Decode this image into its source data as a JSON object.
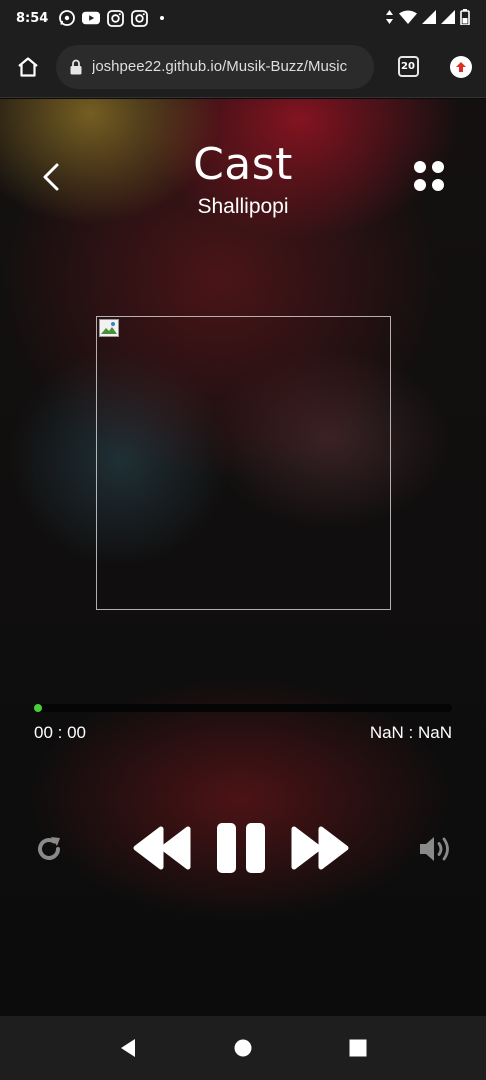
{
  "status_bar": {
    "time": "8:54",
    "icons": [
      "whatsapp-icon",
      "youtube-icon",
      "instagram-icon",
      "instagram-icon",
      "dot-icon"
    ],
    "right_icons": [
      "data-arrows-icon",
      "wifi-icon",
      "signal-icon",
      "signal-icon",
      "battery-icon"
    ]
  },
  "browser": {
    "url": "joshpee22.github.io/Musik-Buzz/Music",
    "tab_count": "20",
    "icons": {
      "home": "home-icon",
      "lock": "lock-icon",
      "update": "update-arrow-icon"
    }
  },
  "player": {
    "title": "Cast",
    "artist": "Shallipopi",
    "current_time": "00 : 00",
    "total_time": "NaN : NaN",
    "progress": 0.01,
    "accent_color": "#4ccd3a",
    "icons": {
      "back": "chevron-left-icon",
      "menu": "grid-dots-icon",
      "repeat": "repeat-icon",
      "rewind": "rewind-icon",
      "pause": "pause-icon",
      "forward": "fast-forward-icon",
      "volume": "volume-icon"
    }
  },
  "nav": {
    "icons": [
      "nav-back-icon",
      "nav-home-icon",
      "nav-recents-icon"
    ]
  }
}
